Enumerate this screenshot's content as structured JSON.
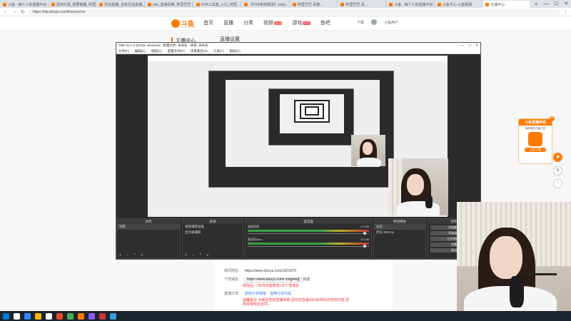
{
  "browser": {
    "tabs": [
      {
        "label": "斗鱼 - 每个人的直播平台",
        "active": false
      },
      {
        "label": "坚持乐观_我要锦鲤_阿里巴...",
        "active": false
      },
      {
        "label": "原创直播_全新互动直播_扫...",
        "active": false
      },
      {
        "label": "obs_直播间推_阿里巴巴 百...",
        "active": false
      },
      {
        "label": "OTA工具盒_入口_阿里...",
        "active": false
      },
      {
        "label": "【OTA系统概述】(ota)...",
        "active": false
      },
      {
        "label": "阿里巴巴 百度...",
        "active": false
      },
      {
        "label": "阿里巴巴 百...",
        "active": false
      },
      {
        "label": "斗鱼 - 每个人的直播平台",
        "active": false
      },
      {
        "label": "斗鱼中心-斗鱼视频",
        "active": false
      },
      {
        "label": "主播中心",
        "active": true
      }
    ],
    "new_tab": "+",
    "window_controls": [
      "—",
      "☐",
      "✕"
    ],
    "url": "https://mp.douyu.com/live/anchor",
    "nav_back": "←",
    "nav_forward": "→",
    "nav_reload": "↻",
    "menu": "⋮"
  },
  "site": {
    "logo_text": "斗鱼",
    "logo_sub": "DOUYU.COM",
    "nav": [
      {
        "label": "首页",
        "highlight": false
      },
      {
        "label": "直播",
        "highlight": false
      },
      {
        "label": "分类",
        "highlight": false
      },
      {
        "label": "视频",
        "highlight": false,
        "badge": "NEW"
      },
      {
        "label": "游戏",
        "highlight": false,
        "badge": "HOT"
      },
      {
        "label": "鱼吧",
        "highlight": false
      }
    ],
    "user_upload": "下载",
    "user_name": "斗鱼用户"
  },
  "page": {
    "sidebar_title": "主播中心",
    "heading": "直播设置",
    "rows": {
      "room_label": "房间地址:",
      "room_value": "https://www.douyu.com/1001670",
      "domain_label": "个性域名:",
      "domain_value": "https://www.douyu.com/ longfengxiaya",
      "domain_btn": "完成",
      "domain_hint": "修改后,一年内仅能修改1次个性域名",
      "share_label": "直播分享:",
      "share_links": [
        "复制分享链接",
        "复制分享代码"
      ],
      "warn_text": "温馨提示:为保证您的直播效果,请勿在直播间内出现任何违规内容,否则将按规定处罚。"
    }
  },
  "promo": {
    "title": "斗鱼直播伴侣",
    "desc": "最简单的开播工具",
    "button": "立即下载",
    "close": "×"
  },
  "side_tools": [
    "◉",
    "⚙",
    "↑"
  ],
  "obs": {
    "title": "OBS 23.1.0 (64-bit, windows) - 配置文件: 未命名 - 场景: 未命名",
    "window_controls": [
      "—",
      "☐",
      "✕"
    ],
    "menu": [
      "文件(F)",
      "编辑(E)",
      "视图(V)",
      "配置文件(P)",
      "场景集合(S)",
      "工具(T)",
      "帮助(H)"
    ],
    "docks": {
      "scenes": {
        "header": "场景",
        "items": [
          "场景"
        ]
      },
      "sources": {
        "header": "来源",
        "items": [
          "视频捕获设备",
          "显示器捕获"
        ]
      },
      "mixer": {
        "header": "混音器",
        "tracks": [
          {
            "name": "桌面音频",
            "db": "0.0 dB"
          },
          {
            "name": "麦克风/Aux",
            "db": "0.0 dB"
          }
        ]
      },
      "transitions": {
        "header": "转场特效",
        "mode": "淡出",
        "duration_label": "时长",
        "duration": "300 ms"
      },
      "controls": {
        "header": "控件",
        "buttons": [
          "开始推流",
          "开始录制",
          "工作室模式",
          "设置",
          "退出"
        ]
      }
    },
    "dock_footer": "+ − ^ v"
  },
  "taskbar": {
    "icons": [
      "#0078d7",
      "#ffffff",
      "#2d8cff",
      "#ffb900",
      "#ffffff",
      "#e34c26",
      "#4caf50",
      "#ff7a00",
      "#8a5cf6",
      "#d13438",
      "#3a9bd9"
    ]
  }
}
